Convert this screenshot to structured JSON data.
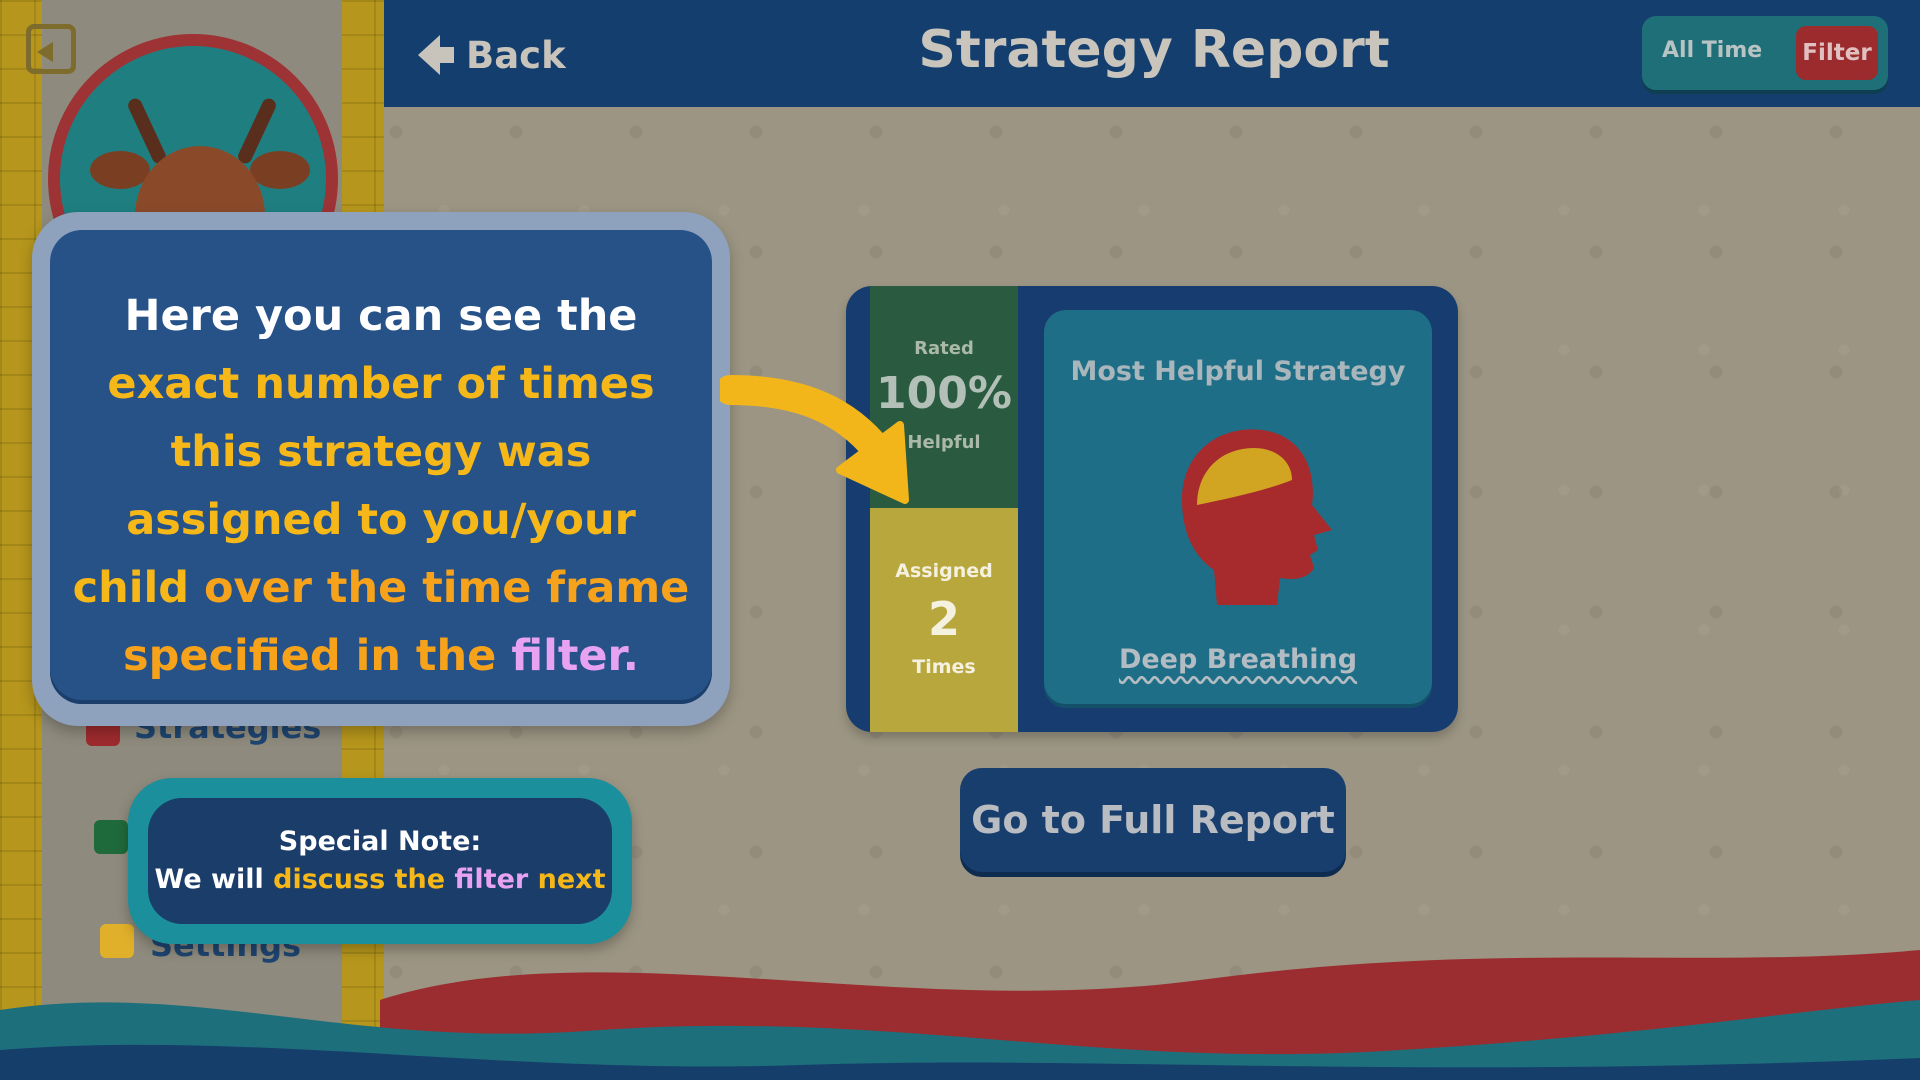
{
  "header": {
    "back_label": "Back",
    "title": "Strategy Report",
    "filter_period": "All Time",
    "filter_label": "Filter"
  },
  "sidebar": {
    "items": [
      {
        "label": "Strategies",
        "icon": "head-icon"
      },
      {
        "label": "",
        "icon": "chart-icon"
      },
      {
        "label": "Settings",
        "icon": "sliders-icon"
      }
    ]
  },
  "strategy_card": {
    "rated_label": "Rated",
    "rated_value": "100%",
    "rated_sub": "Helpful",
    "assigned_label": "Assigned",
    "assigned_value": "2",
    "assigned_sub": "Times",
    "panel_title": "Most Helpful Strategy",
    "strategy_name": "Deep Breathing"
  },
  "full_report_label": "Go to Full Report",
  "callout": {
    "line1": "Here you can see the",
    "line2": "exact number of times",
    "line3": "this strategy was",
    "line4": "assigned to you/your",
    "line5a": "child",
    "line5b": " over the time frame",
    "line6a": "specified in the ",
    "line6b": "filter."
  },
  "note": {
    "title": "Special Note:",
    "prefix": "We will ",
    "middle": "discuss the ",
    "filter_word": "filter",
    "suffix": " next"
  },
  "colors": {
    "header_bg": "#143e6d",
    "accent_yellow": "#f6b819",
    "accent_purple": "#e7a3f2",
    "filter_red": "#9c2b2e",
    "teal": "#1b8f9b"
  }
}
